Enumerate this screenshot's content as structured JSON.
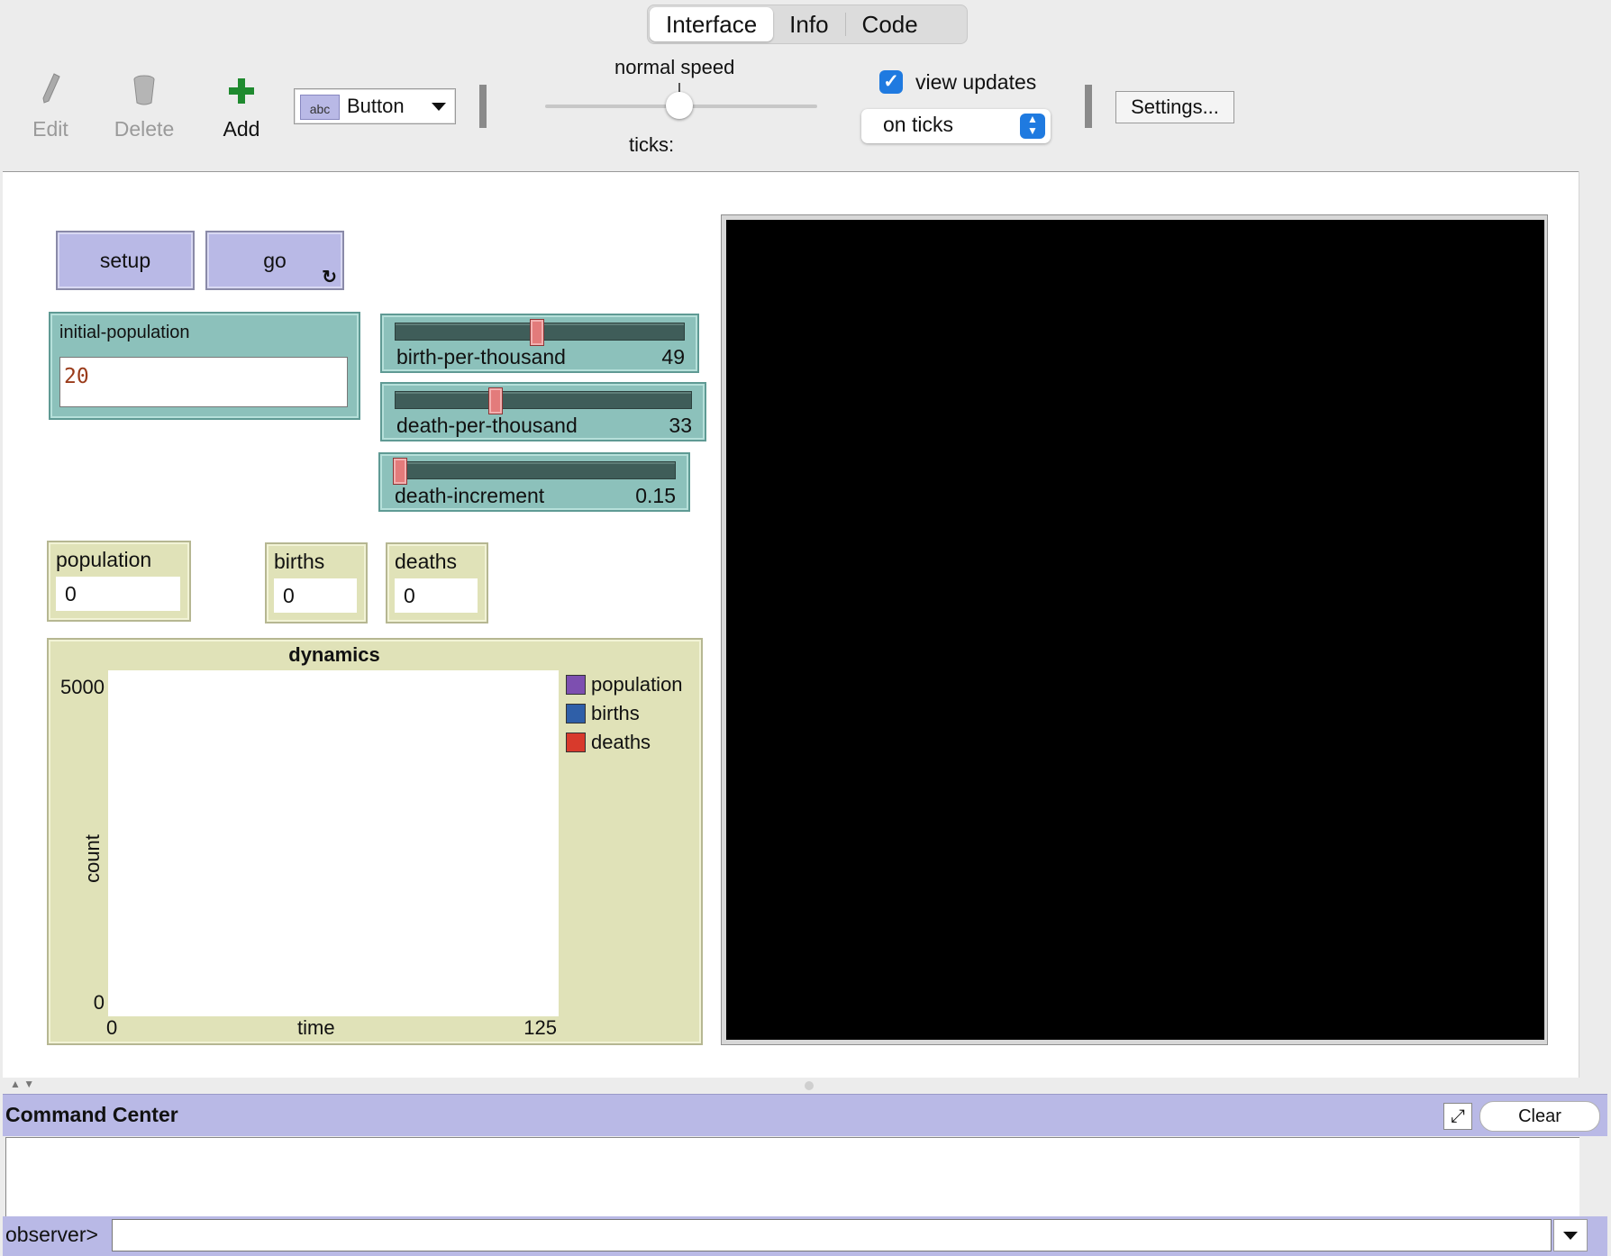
{
  "tabs": [
    "Interface",
    "Info",
    "Code"
  ],
  "toolbar": {
    "edit_label": "Edit",
    "delete_label": "Delete",
    "add_label": "Add",
    "widget_type": "Button",
    "widget_icon_text": "abc",
    "speed_label": "normal speed",
    "ticks_label": "ticks:",
    "view_updates_label": "view updates",
    "view_updates_checked": true,
    "update_mode": "on ticks",
    "settings_label": "Settings..."
  },
  "buttons": {
    "setup": "setup",
    "go": "go",
    "go_forever_icon": "↻"
  },
  "inputs": {
    "initial_population": {
      "label": "initial-population",
      "value": "20"
    }
  },
  "sliders": [
    {
      "name": "birth-per-thousand",
      "value": "49",
      "position": 0.49
    },
    {
      "name": "death-per-thousand",
      "value": "33",
      "position": 0.33
    },
    {
      "name": "death-increment",
      "value": "0.15",
      "position": 0.0
    }
  ],
  "monitors": {
    "population": {
      "label": "population",
      "value": "0"
    },
    "births": {
      "label": "births",
      "value": "0"
    },
    "deaths": {
      "label": "deaths",
      "value": "0"
    }
  },
  "chart_data": {
    "type": "line",
    "title": "dynamics",
    "xlabel": "time",
    "ylabel": "count",
    "xlim": [
      0,
      125
    ],
    "ylim": [
      0,
      5000
    ],
    "x_tick_labels": [
      "0",
      "125"
    ],
    "y_tick_labels": [
      "5000",
      "0"
    ],
    "legend_placement": "right",
    "series": [
      {
        "name": "population",
        "color": "#7d4fb0",
        "values": []
      },
      {
        "name": "births",
        "color": "#2f5fa8",
        "values": []
      },
      {
        "name": "deaths",
        "color": "#d83a2c",
        "values": []
      }
    ]
  },
  "command_center": {
    "title": "Command Center",
    "clear_label": "Clear",
    "prompt": "observer>"
  },
  "colors": {
    "button_bg": "#b9b9e6",
    "slider_bg": "#8cc1bb",
    "monitor_bg": "#e0e2b8",
    "view_bg": "#000000",
    "input_value": "#9a3b1a"
  }
}
